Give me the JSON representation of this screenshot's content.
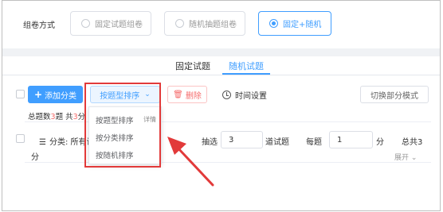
{
  "top": {
    "mode_label": "组卷方式",
    "options": [
      {
        "label": "固定试题组卷",
        "selected": false
      },
      {
        "label": "随机抽题组卷",
        "selected": false
      },
      {
        "label": "固定+随机",
        "selected": true
      }
    ]
  },
  "tabs": [
    {
      "label": "固定试题",
      "active": false
    },
    {
      "label": "随机试题",
      "active": true
    }
  ],
  "toolbar": {
    "add_label": "添加分类",
    "sort_label": "按题型排序",
    "delete_label": "删除",
    "time_label": "时间设置",
    "switch_label": "切换部分模式"
  },
  "summary": {
    "prefix": "总题数",
    "total_questions": "3",
    "mid": "题 共",
    "total_score": "3",
    "suffix": "分"
  },
  "dropdown": {
    "items": [
      "按题型排序",
      "按分类排序",
      "按随机排序"
    ],
    "detail_label": "详情"
  },
  "category_row": {
    "label": "分类: 所有试",
    "draw_label": "抽选",
    "draw_value": "3",
    "draw_unit": "道试题",
    "per_label": "每题",
    "per_value": "1",
    "per_unit": "分",
    "total_label": "总共3",
    "wrap_unit": "分",
    "expand_label": "展开"
  },
  "colors": {
    "accent": "#409eff",
    "danger": "#f56c6c",
    "annotation": "#e23a3a"
  }
}
